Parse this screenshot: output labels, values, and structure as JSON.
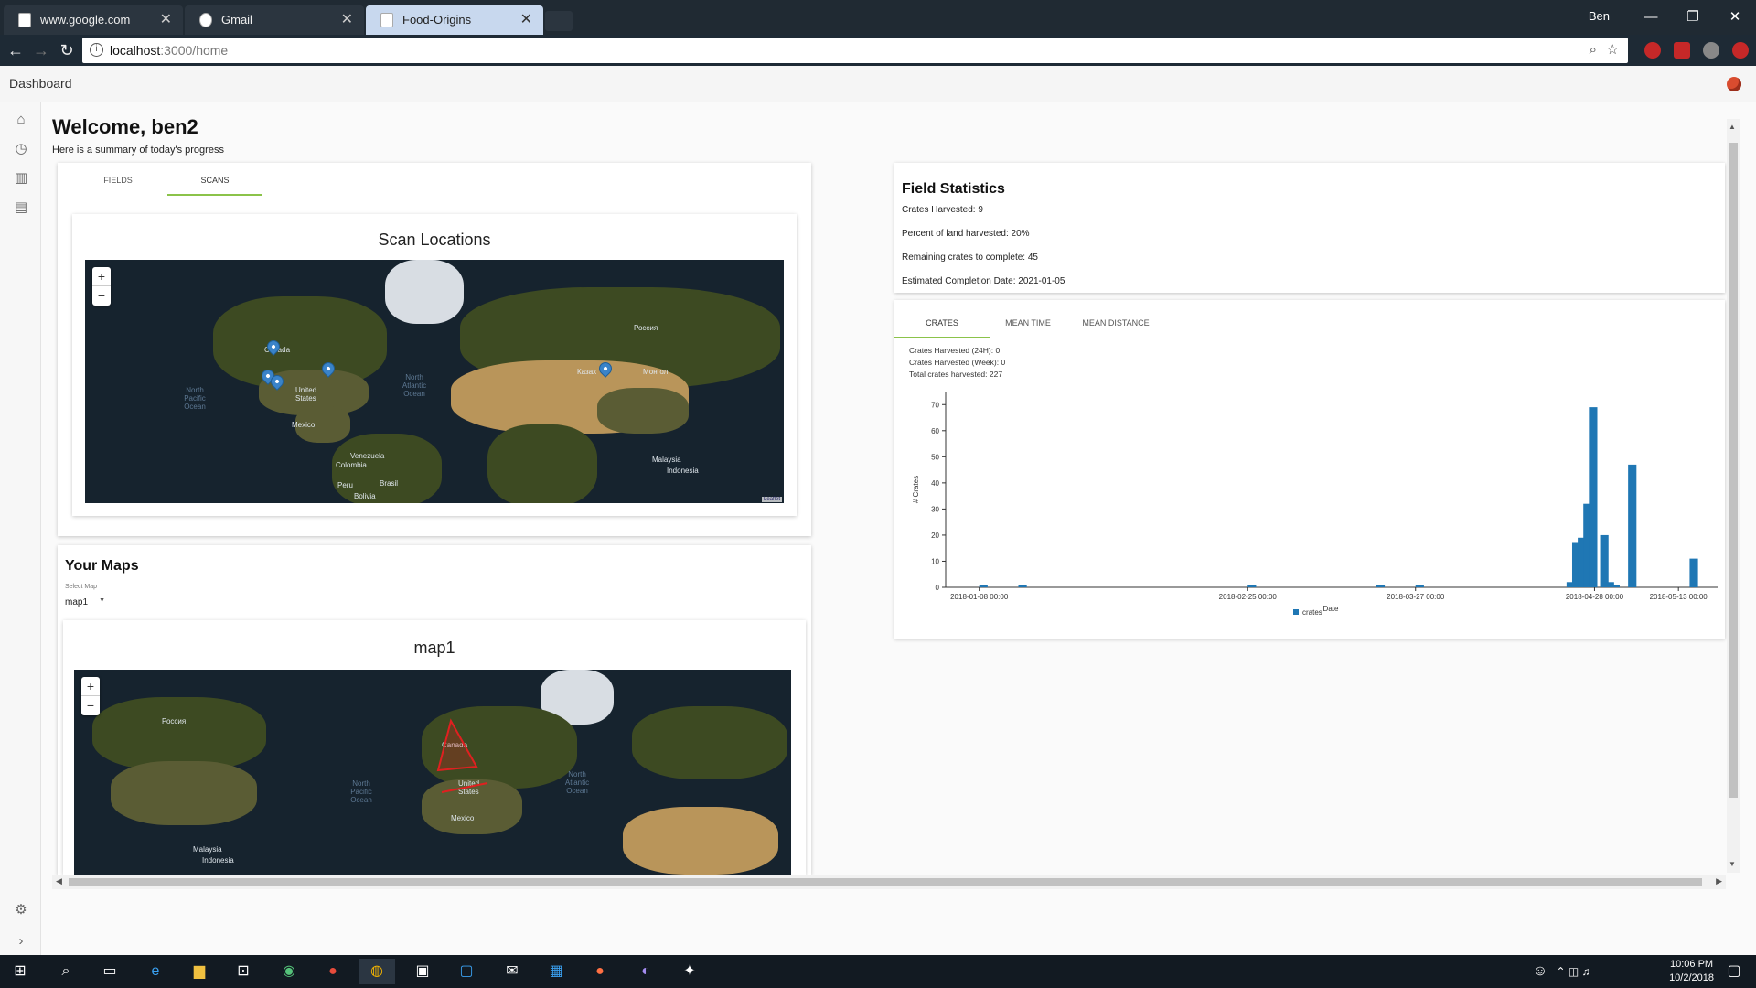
{
  "browser": {
    "tabs": [
      {
        "label": "www.google.com",
        "active": false
      },
      {
        "label": "Gmail",
        "active": false
      },
      {
        "label": "Food-Origins",
        "active": true
      }
    ],
    "user": "Ben",
    "url_host": "localhost",
    "url_path": ":3000/home"
  },
  "app": {
    "title": "Dashboard"
  },
  "welcome": {
    "title": "Welcome, ben2",
    "subtitle": "Here is a summary of today's progress"
  },
  "scan_card": {
    "tabs": [
      "FIELDS",
      "SCANS"
    ],
    "selected_tab": "SCANS",
    "map_title": "Scan Locations",
    "attribution": "Leaflet"
  },
  "your_maps": {
    "title": "Your Maps",
    "select_label": "Select Map",
    "selected_map": "map1",
    "map_title": "map1"
  },
  "map_labels": {
    "canada": "Canada",
    "united_states": "United States",
    "mexico": "Mexico",
    "russia": "Россия",
    "north_pacific": "North Pacific Ocean",
    "north_atlantic": "North Atlantic Ocean",
    "venezuela": "Venezuela",
    "colombia": "Colombia",
    "brasil": "Brasil",
    "peru": "Peru",
    "bolivia": "Bolivia",
    "kazakhstan": "Казах",
    "mongolia": "Монгол",
    "malaysia": "Malaysia",
    "indonesia": "Indonesia"
  },
  "field_statistics": {
    "title": "Field Statistics",
    "lines": [
      "Crates Harvested: 9",
      "Percent of land harvested: 20%",
      "Remaining crates to complete: 45",
      "Estimated Completion Date: 2021-01-05"
    ]
  },
  "chart_card": {
    "tabs": [
      "CRATES",
      "MEAN TIME",
      "MEAN DISTANCE"
    ],
    "selected_tab": "CRATES",
    "info": [
      "Crates Harvested (24H): 0",
      "Crates Harvested (Week): 0",
      "Total crates harvested: 227"
    ]
  },
  "chart_data": {
    "type": "bar",
    "xlabel": "Date",
    "ylabel": "# Crates",
    "ylim": [
      0,
      75
    ],
    "yticks": [
      0,
      10,
      20,
      30,
      40,
      50,
      60,
      70
    ],
    "xtick_labels": [
      "2018-01-08 00:00",
      "2018-02-25 00:00",
      "2018-03-27 00:00",
      "2018-04-28 00:00",
      "2018-05-13 00:00"
    ],
    "legend": "crates",
    "color": "#1f77b4",
    "bars": [
      {
        "x": "2018-01-08",
        "y": 1
      },
      {
        "x": "2018-01-15",
        "y": 1
      },
      {
        "x": "2018-02-25",
        "y": 1
      },
      {
        "x": "2018-03-20",
        "y": 1
      },
      {
        "x": "2018-03-27",
        "y": 1
      },
      {
        "x": "2018-04-23",
        "y": 2
      },
      {
        "x": "2018-04-24",
        "y": 17
      },
      {
        "x": "2018-04-25",
        "y": 19
      },
      {
        "x": "2018-04-26",
        "y": 32
      },
      {
        "x": "2018-04-27",
        "y": 69
      },
      {
        "x": "2018-04-29",
        "y": 20
      },
      {
        "x": "2018-04-30",
        "y": 2
      },
      {
        "x": "2018-05-01",
        "y": 1
      },
      {
        "x": "2018-05-04",
        "y": 47
      },
      {
        "x": "2018-05-15",
        "y": 11
      }
    ]
  },
  "taskbar": {
    "time": "10:06 PM",
    "date": "10/2/2018"
  }
}
